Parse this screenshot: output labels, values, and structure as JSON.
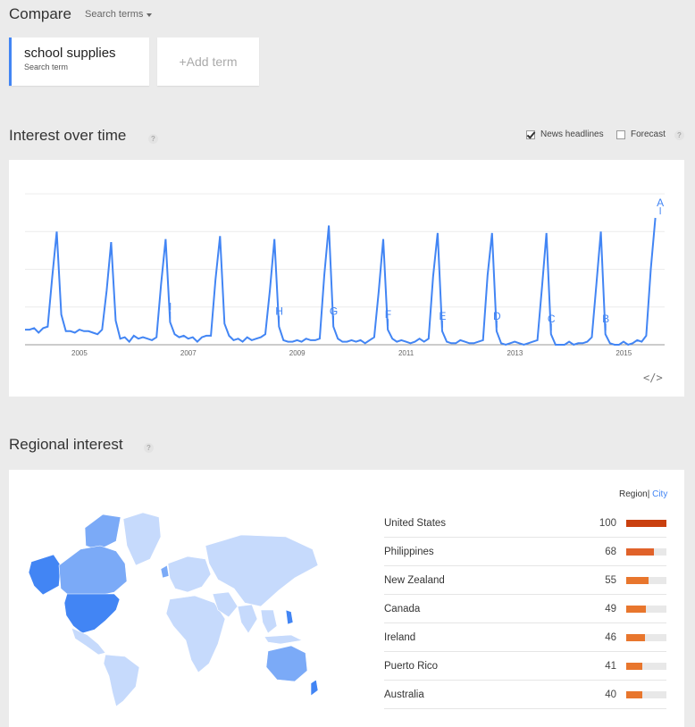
{
  "header": {
    "title": "Compare",
    "search_terms_label": "Search terms"
  },
  "terms": [
    {
      "name": "school supplies",
      "subtitle": "Search term"
    }
  ],
  "add_term_label": "+Add term",
  "interest_over_time": {
    "title": "Interest over time",
    "help": "?",
    "news_headlines_label": "News headlines",
    "news_headlines_checked": true,
    "forecast_label": "Forecast",
    "forecast_checked": false,
    "embed_label": "</>"
  },
  "chart_data": {
    "type": "line",
    "series": [
      {
        "color": "#4285f4",
        "x_start": 2004.0,
        "step": 0.0833,
        "values": [
          10,
          10,
          11,
          8,
          11,
          12,
          45,
          75,
          20,
          9,
          9,
          8,
          10,
          9,
          9,
          8,
          7,
          10,
          36,
          68,
          16,
          4,
          5,
          2,
          6,
          4,
          5,
          4,
          3,
          5,
          40,
          70,
          15,
          7,
          5,
          6,
          4,
          5,
          2,
          5,
          6,
          6,
          43,
          72,
          14,
          6,
          3,
          4,
          2,
          5,
          3,
          4,
          5,
          7,
          36,
          70,
          12,
          3,
          2,
          2,
          3,
          2,
          4,
          3,
          3,
          4,
          46,
          79,
          12,
          4,
          2,
          2,
          3,
          2,
          3,
          1,
          3,
          5,
          35,
          70,
          10,
          4,
          2,
          3,
          2,
          1,
          2,
          4,
          2,
          4,
          45,
          74,
          9,
          2,
          1,
          1,
          3,
          2,
          1,
          1,
          2,
          3,
          46,
          74,
          9,
          1,
          0,
          1,
          2,
          1,
          0,
          1,
          2,
          3,
          38,
          74,
          7,
          0,
          0,
          0,
          2,
          0,
          1,
          1,
          2,
          5,
          40,
          75,
          7,
          1,
          0,
          0,
          2,
          0,
          1,
          3,
          2,
          6,
          50,
          84
        ]
      }
    ],
    "x_ticks": [
      "2005",
      "2007",
      "2009",
      "2011",
      "2013",
      "2015"
    ],
    "x_tick_values": [
      2005,
      2007,
      2009,
      2011,
      2013,
      2015
    ],
    "ylim": [
      0,
      100
    ],
    "markers": [
      {
        "label": "I",
        "x": 2006.67
      },
      {
        "label": "H",
        "x": 2008.67
      },
      {
        "label": "G",
        "x": 2009.67
      },
      {
        "label": "F",
        "x": 2010.67
      },
      {
        "label": "E",
        "x": 2011.67
      },
      {
        "label": "D",
        "x": 2012.67
      },
      {
        "label": "C",
        "x": 2013.67
      },
      {
        "label": "B",
        "x": 2014.67
      },
      {
        "label": "A",
        "x": 2015.67
      }
    ],
    "grid": true
  },
  "regional": {
    "title": "Regional interest",
    "help": "?",
    "region_label": "Region",
    "city_label": "City",
    "rows": [
      {
        "name": "United States",
        "value": "100",
        "pct": 100,
        "color": "#c9400f"
      },
      {
        "name": "Philippines",
        "value": "68",
        "pct": 68,
        "color": "#e0622a"
      },
      {
        "name": "New Zealand",
        "value": "55",
        "pct": 55,
        "color": "#e8762d"
      },
      {
        "name": "Canada",
        "value": "49",
        "pct": 49,
        "color": "#e8762d"
      },
      {
        "name": "Ireland",
        "value": "46",
        "pct": 46,
        "color": "#e8762d"
      },
      {
        "name": "Puerto Rico",
        "value": "41",
        "pct": 41,
        "color": "#e8762d"
      },
      {
        "name": "Australia",
        "value": "40",
        "pct": 40,
        "color": "#e8762d"
      }
    ]
  },
  "colors": {
    "accent": "#4285f4",
    "map_high": "#4285f4",
    "map_mid": "#7baaf7",
    "map_low": "#c6dafc"
  }
}
